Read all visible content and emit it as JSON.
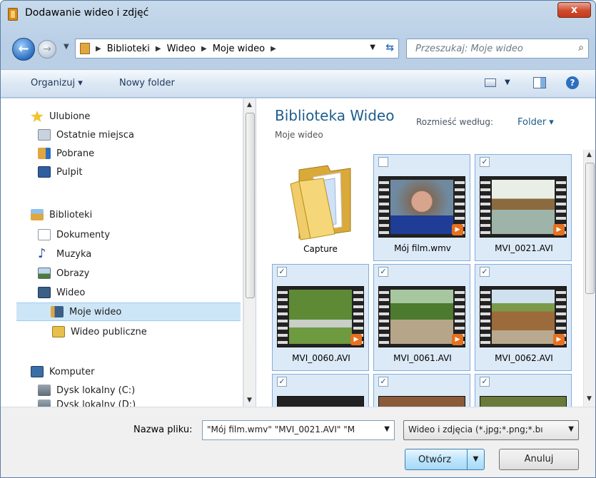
{
  "window": {
    "title": "Dodawanie wideo i zdjęć",
    "close_label": "x"
  },
  "address": {
    "crumbs": [
      "Biblioteki",
      "Wideo",
      "Moje wideo"
    ],
    "search_placeholder": "Przeszukaj: Moje wideo"
  },
  "toolbar": {
    "organize_label": "Organizuj ▾",
    "new_folder_label": "Nowy folder",
    "help_label": "?"
  },
  "nav": {
    "favorites": {
      "label": "Ulubione",
      "items": [
        "Ostatnie miejsca",
        "Pobrane",
        "Pulpit"
      ]
    },
    "libraries": {
      "label": "Biblioteki",
      "items": [
        "Dokumenty",
        "Muzyka",
        "Obrazy",
        "Wideo"
      ],
      "sub_items": [
        "Moje wideo",
        "Wideo publiczne"
      ]
    },
    "computer": {
      "label": "Komputer",
      "items": [
        "Dysk lokalny (C:)",
        "Dysk lokalny (D:)"
      ]
    }
  },
  "content": {
    "library_title": "Biblioteka Wideo",
    "library_subtitle": "Moje wideo",
    "arrange_label": "Rozmieść według:",
    "arrange_value": "Folder ▾",
    "items": [
      {
        "name": "Capture",
        "type": "folder",
        "selected": false
      },
      {
        "name": "Mój film.wmv",
        "type": "video",
        "selected": true,
        "checked": false
      },
      {
        "name": "MVI_0021.AVI",
        "type": "video",
        "selected": true,
        "checked": true
      },
      {
        "name": "MVI_0060.AVI",
        "type": "video",
        "selected": true,
        "checked": true
      },
      {
        "name": "MVI_0061.AVI",
        "type": "video",
        "selected": true,
        "checked": true
      },
      {
        "name": "MVI_0062.AVI",
        "type": "video",
        "selected": true,
        "checked": true
      }
    ]
  },
  "footer": {
    "filename_label": "Nazwa pliku:",
    "filename_value": "\"Mój film.wmv\" \"MVI_0021.AVI\" \"M",
    "filetype_value": "Wideo i zdjęcia (*.jpg;*.png;*.bı",
    "open_label": "Otwórz",
    "cancel_label": "Anuluj"
  },
  "colors": {
    "accent": "#1e5d8c",
    "selection": "#dceaf7",
    "selection_border": "#84acdd"
  }
}
